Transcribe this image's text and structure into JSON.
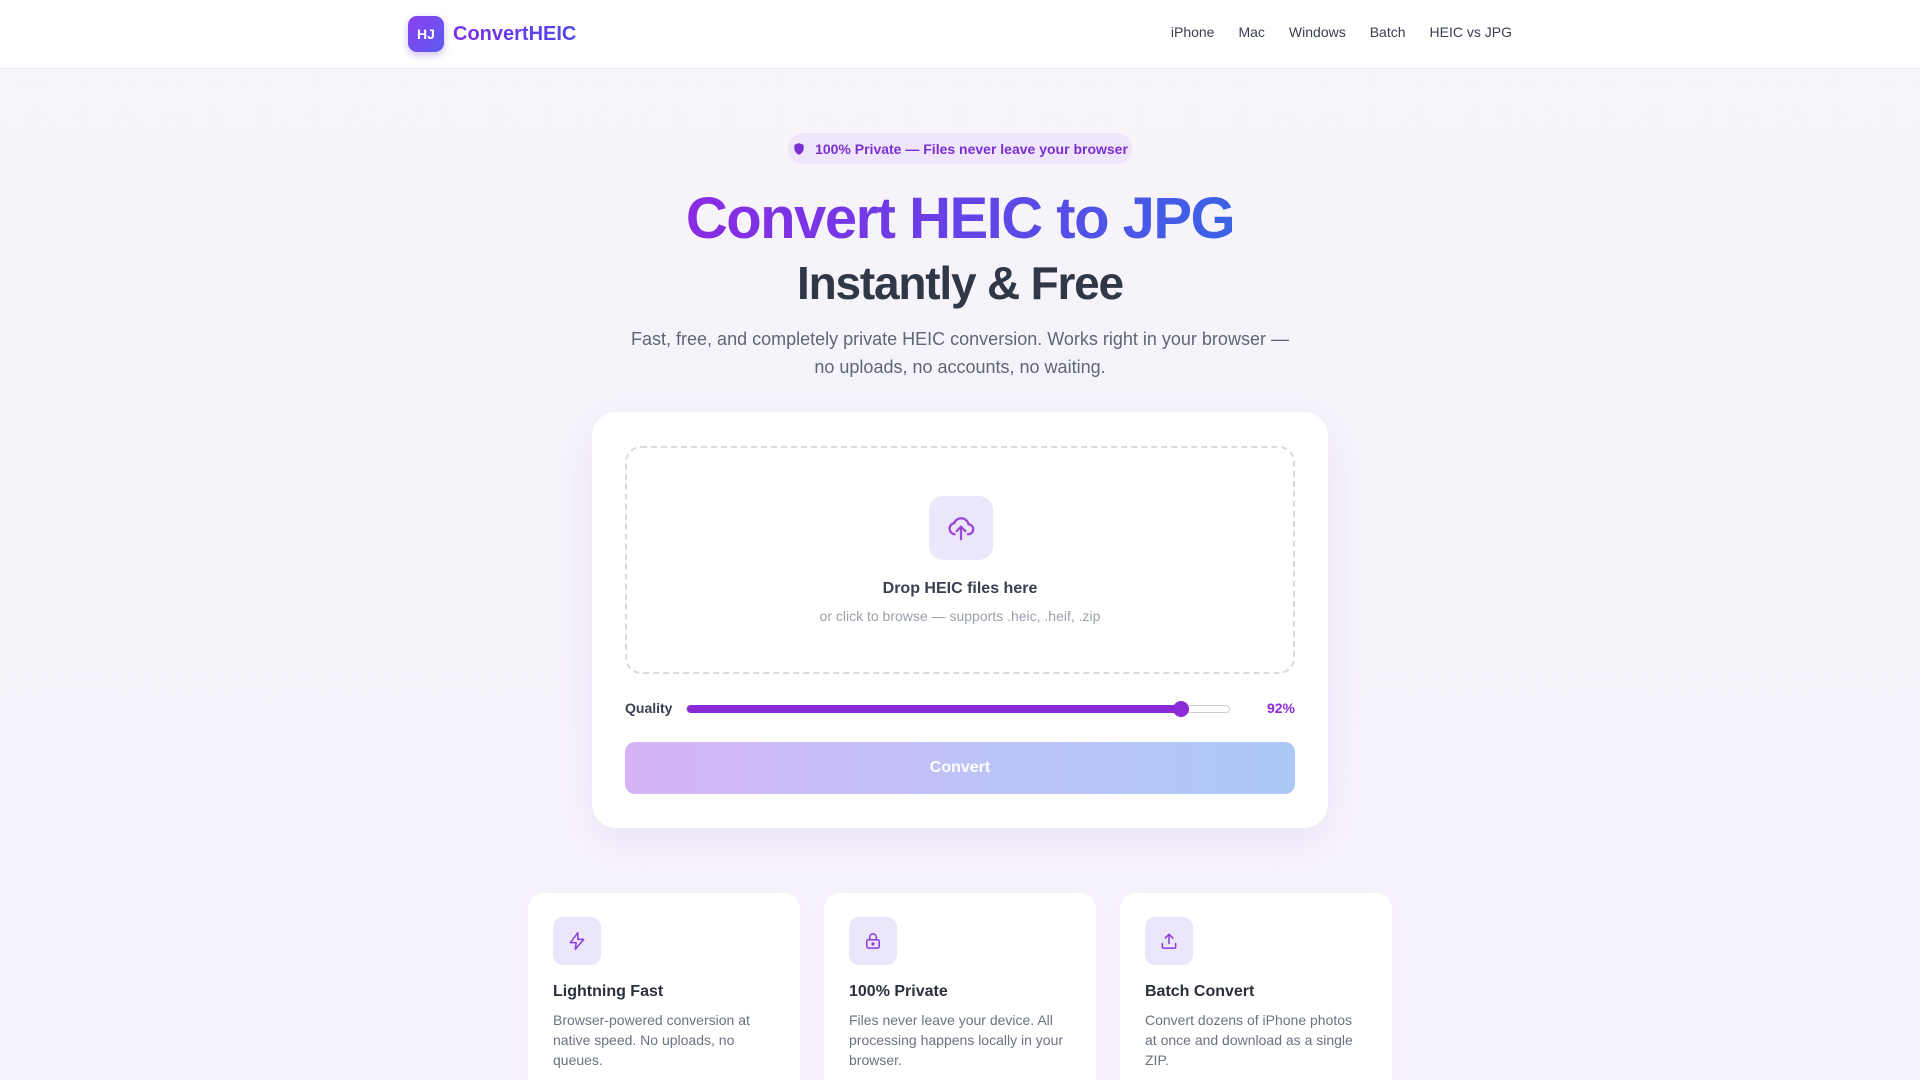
{
  "header": {
    "logo_mark": "HJ",
    "logo_text": "ConvertHEIC",
    "nav": [
      "iPhone",
      "Mac",
      "Windows",
      "Batch",
      "HEIC vs JPG"
    ]
  },
  "hero": {
    "badge": "100% Private — Files never leave your browser",
    "title": "Convert HEIC to JPG",
    "subtitle": "Instantly & Free",
    "lead": "Fast, free, and completely private HEIC conversion. Works right in your browser — no uploads, no accounts, no waiting."
  },
  "converter": {
    "drop_title": "Drop HEIC files here",
    "drop_subtitle": "or click to browse — supports .heic, .heif, .zip",
    "quality_label": "Quality",
    "quality_value": 92,
    "quality_display": "92%",
    "convert_label": "Convert"
  },
  "features": [
    {
      "icon": "lightning-icon",
      "title": "Lightning Fast",
      "text": "Browser-powered conversion at native speed. No uploads, no queues."
    },
    {
      "icon": "lock-icon",
      "title": "100% Private",
      "text": "Files never leave your device. All processing happens locally in your browser."
    },
    {
      "icon": "upload-icon",
      "title": "Batch Convert",
      "text": "Convert dozens of iPhone photos at once and download as a single ZIP."
    }
  ],
  "colors": {
    "accent": "#8a2bd6",
    "brand_gradient_start": "#8a2be2",
    "brand_gradient_end": "#3b63e6"
  }
}
